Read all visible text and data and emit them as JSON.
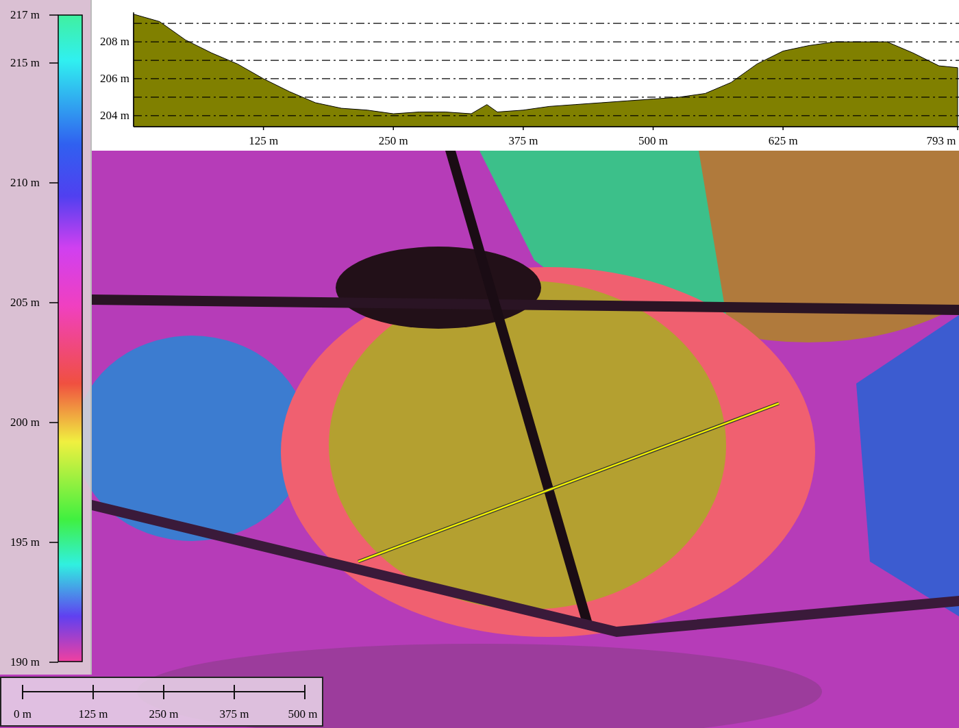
{
  "profile": {
    "chart_data": {
      "type": "area",
      "x": [
        0,
        25,
        50,
        75,
        100,
        125,
        150,
        175,
        200,
        225,
        250,
        275,
        300,
        325,
        340,
        350,
        375,
        400,
        425,
        450,
        475,
        500,
        525,
        550,
        575,
        600,
        625,
        650,
        675,
        700,
        725,
        750,
        775,
        793
      ],
      "series": [
        {
          "color": "#808000",
          "values": [
            209.5,
            209.1,
            208.1,
            207.4,
            206.8,
            206.0,
            205.3,
            204.7,
            204.4,
            204.3,
            204.1,
            204.2,
            204.2,
            204.1,
            204.6,
            204.2,
            204.3,
            204.5,
            204.6,
            204.7,
            204.8,
            204.9,
            205.0,
            205.2,
            205.8,
            206.8,
            207.5,
            207.8,
            208.0,
            208.0,
            208.0,
            207.4,
            206.7,
            206.6
          ]
        }
      ],
      "grid": true,
      "xlim": [
        0,
        793
      ],
      "ylim": [
        203.4,
        209.6
      ],
      "xticks": [
        {
          "value": 125,
          "label": "125 m"
        },
        {
          "value": 250,
          "label": "250 m"
        },
        {
          "value": 375,
          "label": "375 m"
        },
        {
          "value": 500,
          "label": "500 m"
        },
        {
          "value": 625,
          "label": "625 m"
        },
        {
          "value": 793,
          "label": "793 m"
        }
      ],
      "yticks": [
        {
          "value": 204,
          "label": "204 m"
        },
        {
          "value": 206,
          "label": "206 m"
        },
        {
          "value": 208,
          "label": "208 m"
        }
      ]
    }
  },
  "legend": {
    "labels": [
      "217 m",
      "215 m",
      "210 m",
      "205 m",
      "200 m",
      "195 m",
      "190 m"
    ]
  },
  "scale_bar": {
    "labels": [
      "0 m",
      "125 m",
      "250 m",
      "375 m",
      "500 m"
    ]
  }
}
